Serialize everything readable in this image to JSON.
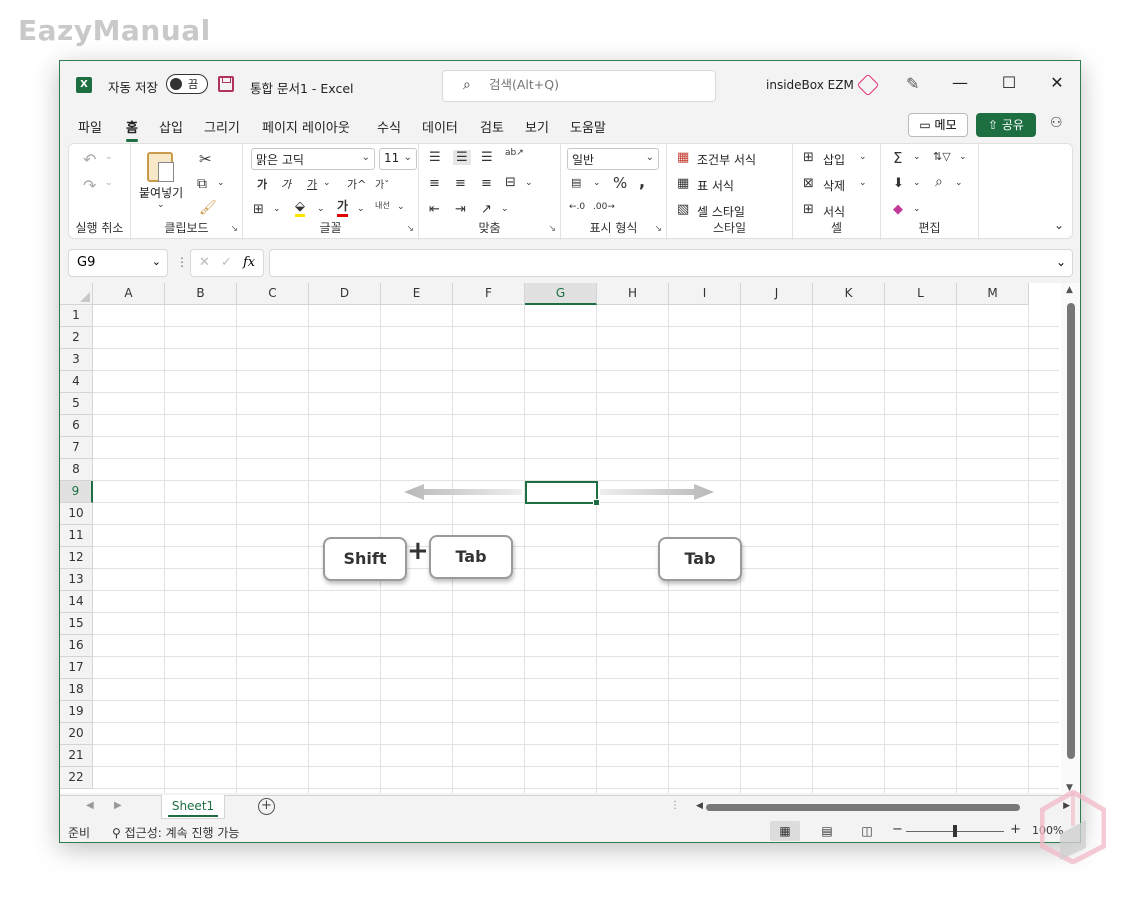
{
  "watermark": "EazyManual",
  "titlebar": {
    "app_icon": "X",
    "autosave_label": "자동 저장",
    "autosave_state": "끔",
    "doc_title": "통합 문서1  -  Excel",
    "search_placeholder": "검색(Alt+Q)",
    "user_name": "insideBox EZM",
    "minimize": "—",
    "maximize": "☐",
    "close": "✕"
  },
  "menu": {
    "items": [
      "파일",
      "홈",
      "삽입",
      "그리기",
      "페이지 레이아웃",
      "수식",
      "데이터",
      "검토",
      "보기",
      "도움말"
    ],
    "active_index": 1,
    "memo_label": "메모",
    "share_label": "공유"
  },
  "ribbon": {
    "groups": {
      "undo": "실행 취소",
      "clipboard": "클립보드",
      "font": "글꼴",
      "alignment": "맞춤",
      "number": "표시 형식",
      "styles": "스타일",
      "cells": "셀",
      "editing": "편집"
    },
    "paste_label": "붙여넣기",
    "font_name": "맑은 고딕",
    "font_size": "11",
    "font_btns": [
      "가",
      "가",
      "가",
      "가^",
      "가ˇ"
    ],
    "wrap_label": "내선",
    "number_format": "일반",
    "conditional_format": "조건부 서식",
    "table_format": "표 서식",
    "cell_style": "셀 스타일",
    "insert": "삽입",
    "delete": "삭제",
    "format": "서식",
    "accent_color": "#1d6f42"
  },
  "formula_bar": {
    "name_box": "G9",
    "fx": "fx",
    "value": ""
  },
  "sheet": {
    "columns": [
      "A",
      "B",
      "C",
      "D",
      "E",
      "F",
      "G",
      "H",
      "I",
      "J",
      "K",
      "L",
      "M"
    ],
    "rows": [
      "1",
      "2",
      "3",
      "4",
      "5",
      "6",
      "7",
      "8",
      "9",
      "10",
      "11",
      "12",
      "13",
      "14",
      "15",
      "16",
      "17",
      "18",
      "19",
      "20",
      "21",
      "22"
    ],
    "selected_col": "G",
    "selected_row": "9"
  },
  "overlay": {
    "key_shift": "Shift",
    "key_plus": "+",
    "key_tab_left": "Tab",
    "key_tab_right": "Tab"
  },
  "tabs": {
    "sheet_name": "Sheet1",
    "add": "+"
  },
  "statusbar": {
    "ready": "준비",
    "accessibility": "접근성: 계속 진행 가능",
    "zoom": "100%"
  }
}
